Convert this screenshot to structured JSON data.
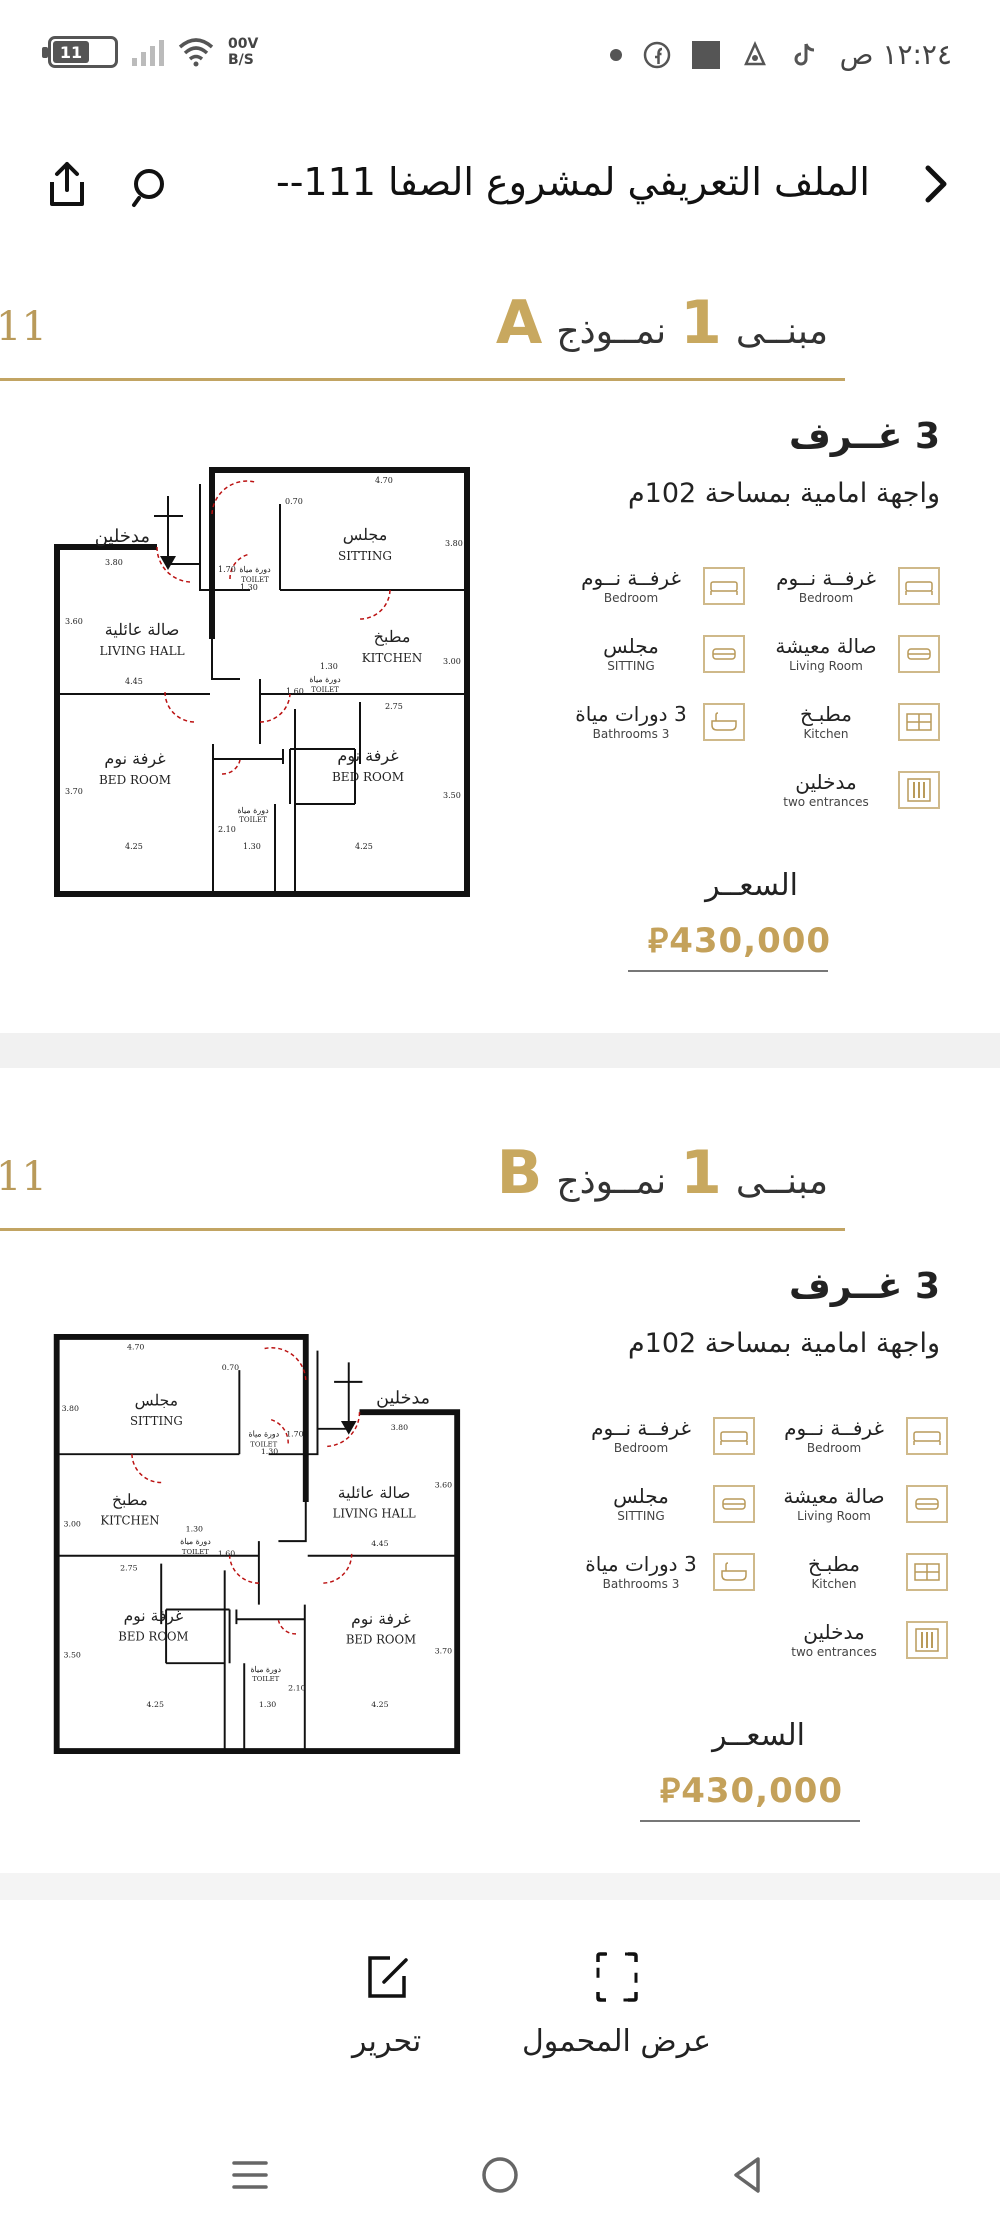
{
  "status_bar": {
    "time": "١٢:٢٤ ص",
    "battery": "11",
    "speed_value": "00V",
    "speed_unit": "B/S"
  },
  "header": {
    "title": "الملف التعريفي لمشروع الصفا 111--"
  },
  "pages": [
    {
      "edge_number": "11",
      "building_word": "مبنــى",
      "building_number": "1",
      "model_word": "نمــوذج",
      "model_letter": "A",
      "rooms": "3 غــرف",
      "facade": "واجهة امامية بمساحة 102م",
      "features": [
        {
          "ar": "غرفــة نــوم",
          "en": "Bedroom",
          "icon": "bed-icon"
        },
        {
          "ar": "غرفــة نــوم",
          "en": "Bedroom",
          "icon": "bed-icon"
        },
        {
          "ar": "صالة معيشة",
          "en": "Living Room",
          "icon": "sofa-icon"
        },
        {
          "ar": "مجلس",
          "en": "SITTING",
          "icon": "sofa-icon"
        },
        {
          "ar": "مطبـخ",
          "en": "Kitchen",
          "icon": "kitchen-icon"
        },
        {
          "ar": "3 دورات مياة",
          "en": "3 Bathrooms",
          "icon": "bathtub-icon"
        },
        {
          "ar": "مدخلين",
          "en": "two entrances",
          "icon": "doors-icon"
        }
      ],
      "price_label": "السعــر",
      "price": "430,000",
      "plan": {
        "entrance": "مدخلين",
        "sitting_ar": "مجلس",
        "sitting_en": "SITTING",
        "living_ar": "صالة عائلية",
        "living_en": "LIVING HALL",
        "kitchen_ar": "مطبخ",
        "kitchen_en": "KITCHEN",
        "bed_ar": "غرفة نوم",
        "bed_en": "BED ROOM",
        "toilet_ar": "دورة مياة",
        "toilet_en": "TOILET",
        "dims": {
          "d470": "4.70",
          "d070": "0.70",
          "d380": "3.80",
          "d380b": "3.80",
          "d170": "1.70",
          "d130": "1.30",
          "d360": "3.60",
          "d445": "4.45",
          "d160": "1.60",
          "d300": "3.00",
          "d275": "2.75",
          "d370": "3.70",
          "d350": "3.50",
          "d210": "2.10",
          "d425": "4.25"
        }
      }
    },
    {
      "edge_number": "11",
      "building_word": "مبنــى",
      "building_number": "1",
      "model_word": "نمــوذج",
      "model_letter": "B",
      "rooms": "3 غــرف",
      "facade": "واجهة امامية بمساحة 102م",
      "features": [
        {
          "ar": "غرفــة نــوم",
          "en": "Bedroom",
          "icon": "bed-icon"
        },
        {
          "ar": "غرفــة نــوم",
          "en": "Bedroom",
          "icon": "bed-icon"
        },
        {
          "ar": "صالة معيشة",
          "en": "Living Room",
          "icon": "sofa-icon"
        },
        {
          "ar": "مجلس",
          "en": "SITTING",
          "icon": "sofa-icon"
        },
        {
          "ar": "مطبـخ",
          "en": "Kitchen",
          "icon": "kitchen-icon"
        },
        {
          "ar": "3 دورات مياة",
          "en": "3 Bathrooms",
          "icon": "bathtub-icon"
        },
        {
          "ar": "مدخلين",
          "en": "two entrances",
          "icon": "doors-icon"
        }
      ],
      "price_label": "السعــر",
      "price": "430,000",
      "plan": {
        "entrance": "مدخلين",
        "sitting_ar": "مجلس",
        "sitting_en": "SITTING",
        "living_ar": "صالة عائلية",
        "living_en": "LIVING HALL",
        "kitchen_ar": "مطبخ",
        "kitchen_en": "KITCHEN",
        "bed_ar": "غرفة نوم",
        "bed_en": "BED ROOM",
        "toilet_ar": "دورة مياة",
        "toilet_en": "TOILET",
        "dims": {
          "d470": "4.70",
          "d070": "0.70",
          "d380": "3.80",
          "d380b": "3.80",
          "d170": "1.70",
          "d130": "1.30",
          "d360": "3.60",
          "d445": "4.45",
          "d160": "1.60",
          "d300": "3.00",
          "d275": "2.75",
          "d370": "3.70",
          "d350": "3.50",
          "d210": "2.10",
          "d425": "4.25"
        }
      }
    }
  ],
  "toolbar": {
    "edit_label": "تحرير",
    "mobile_view_label": "عرض المحمول"
  }
}
